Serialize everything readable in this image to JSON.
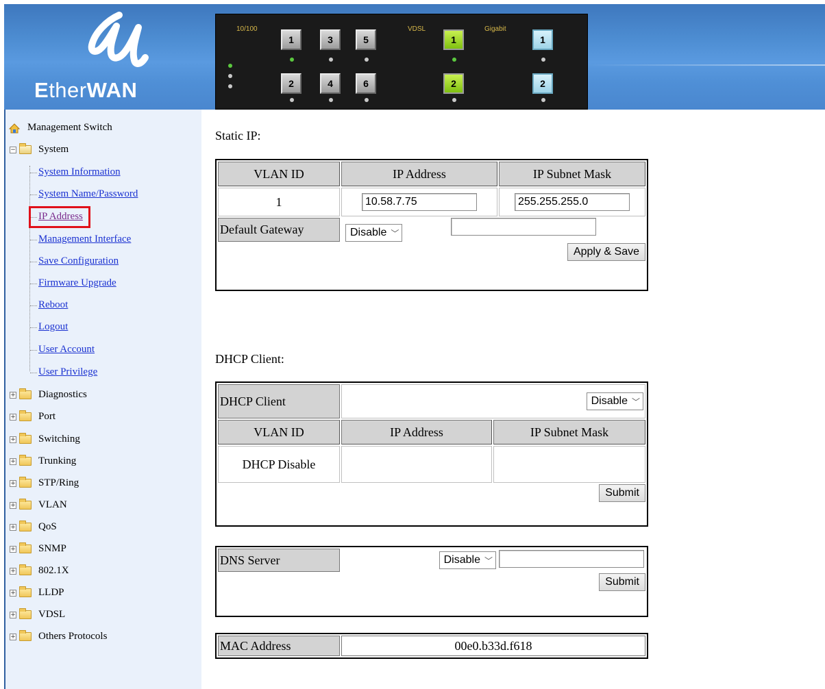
{
  "brand": {
    "logo_text_bold_1": "E",
    "logo_text_1": "ther",
    "logo_text_bold_2": "WAN"
  },
  "port_panel": {
    "label_10_100": "10/100",
    "label_vdsl": "VDSL",
    "label_gigabit": "Gigabit",
    "ports_10_100_top": [
      "1",
      "3",
      "5"
    ],
    "ports_10_100_bottom": [
      "2",
      "4",
      "6"
    ],
    "ports_vdsl": [
      "1",
      "2"
    ],
    "ports_gigabit": [
      "1",
      "2"
    ]
  },
  "sidebar": {
    "root": "Management Switch",
    "system": "System",
    "system_links": [
      "System Information",
      "System Name/Password",
      "IP Address",
      "Management Interface",
      "Save Configuration",
      "Firmware Upgrade",
      "Reboot",
      "Logout",
      "User Account",
      "User Privilege"
    ],
    "folders": [
      "Diagnostics",
      "Port",
      "Switching",
      "Trunking",
      "STP/Ring",
      "VLAN",
      "QoS",
      "SNMP",
      "802.1X",
      "LLDP",
      "VDSL",
      "Others Protocols"
    ]
  },
  "static_ip": {
    "title": "Static IP:",
    "headers": [
      "VLAN ID",
      "IP Address",
      "IP Subnet Mask"
    ],
    "vlan_id": "1",
    "ip_address": "10.58.7.75",
    "subnet_mask": "255.255.255.0",
    "gateway_label": "Default Gateway",
    "gateway_select": "Disable",
    "gateway_value": "",
    "apply_button": "Apply & Save"
  },
  "dhcp": {
    "title": "DHCP Client:",
    "client_label": "DHCP Client",
    "client_select": "Disable",
    "headers": [
      "VLAN ID",
      "IP Address",
      "IP Subnet Mask"
    ],
    "vlan_cell": "DHCP Disable",
    "ip_cell": "",
    "mask_cell": "",
    "submit_button": "Submit"
  },
  "dns": {
    "label": "DNS Server",
    "select": "Disable",
    "value": "",
    "submit_button": "Submit"
  },
  "mac": {
    "label": "MAC Address",
    "value": "00e0.b33d.f618"
  }
}
